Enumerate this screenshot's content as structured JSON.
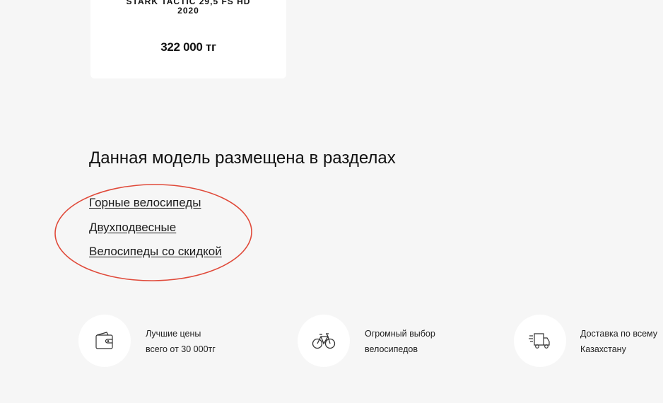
{
  "product": {
    "name": "STARK TACTIC 29,5 FS HD\n2020",
    "price": "322 000 тг"
  },
  "sections": {
    "title": "Данная модель размещена в разделах",
    "links": [
      "Горные велосипеды",
      "Двухподвесные",
      "Велосипеды со скидкой"
    ],
    "highlight_color": "#e04a3a"
  },
  "features": [
    {
      "icon": "wallet-icon",
      "line1": "Лучшие цены",
      "line2": "всего от 30 000тг"
    },
    {
      "icon": "bicycle-icon",
      "line1": "Огромный выбор",
      "line2": "велосипедов"
    },
    {
      "icon": "delivery-truck-icon",
      "line1": "Доставка по всему",
      "line2": "Казахстану"
    }
  ]
}
